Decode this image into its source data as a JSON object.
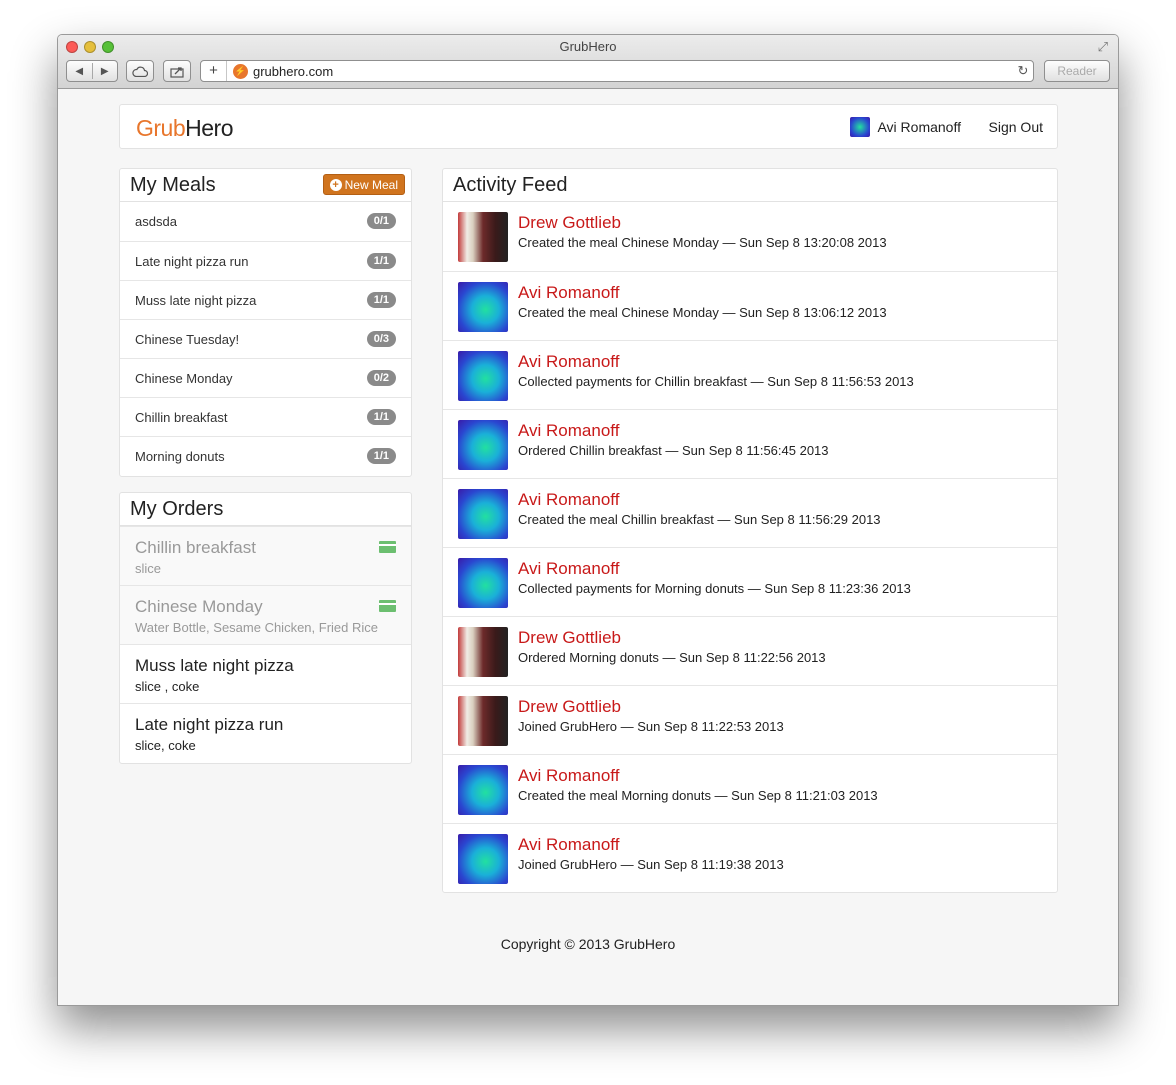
{
  "window": {
    "title": "GrubHero",
    "url": "grubhero.com",
    "reader_label": "Reader"
  },
  "brand": {
    "part1": "Grub",
    "part2": "Hero",
    "accent": "#e8762c"
  },
  "nav": {
    "user_name": "Avi Romanoff",
    "sign_out": "Sign Out"
  },
  "meals": {
    "title": "My Meals",
    "new_meal_label": "New Meal",
    "items": [
      {
        "name": "asdsda",
        "count": "0/1"
      },
      {
        "name": "Late night pizza run",
        "count": "1/1"
      },
      {
        "name": "Muss late night pizza",
        "count": "1/1"
      },
      {
        "name": "Chinese Tuesday!",
        "count": "0/3"
      },
      {
        "name": "Chinese Monday",
        "count": "0/2"
      },
      {
        "name": "Chillin breakfast",
        "count": "1/1"
      },
      {
        "name": "Morning donuts",
        "count": "1/1"
      }
    ]
  },
  "orders": {
    "title": "My Orders",
    "items": [
      {
        "meal": "Chillin breakfast",
        "items": "slice",
        "paid": true
      },
      {
        "meal": "Chinese Monday",
        "items": "Water Bottle, Sesame Chicken, Fried Rice",
        "paid": true
      },
      {
        "meal": "Muss late night pizza",
        "items": "slice , coke",
        "paid": false
      },
      {
        "meal": "Late night pizza run",
        "items": "slice, coke",
        "paid": false
      }
    ]
  },
  "feed": {
    "title": "Activity Feed",
    "name_color": "#c81919",
    "items": [
      {
        "user": "Drew Gottlieb",
        "text": "Created the meal Chinese Monday — Sun Sep 8 13:20:08 2013",
        "avatar": "drew"
      },
      {
        "user": "Avi Romanoff",
        "text": "Created the meal Chinese Monday — Sun Sep 8 13:06:12 2013",
        "avatar": "avi"
      },
      {
        "user": "Avi Romanoff",
        "text": "Collected payments for Chillin breakfast — Sun Sep 8 11:56:53 2013",
        "avatar": "avi"
      },
      {
        "user": "Avi Romanoff",
        "text": "Ordered Chillin breakfast — Sun Sep 8 11:56:45 2013",
        "avatar": "avi"
      },
      {
        "user": "Avi Romanoff",
        "text": "Created the meal Chillin breakfast — Sun Sep 8 11:56:29 2013",
        "avatar": "avi"
      },
      {
        "user": "Avi Romanoff",
        "text": "Collected payments for Morning donuts — Sun Sep 8 11:23:36 2013",
        "avatar": "avi"
      },
      {
        "user": "Drew Gottlieb",
        "text": "Ordered Morning donuts — Sun Sep 8 11:22:56 2013",
        "avatar": "drew"
      },
      {
        "user": "Drew Gottlieb",
        "text": "Joined GrubHero — Sun Sep 8 11:22:53 2013",
        "avatar": "drew"
      },
      {
        "user": "Avi Romanoff",
        "text": "Created the meal Morning donuts — Sun Sep 8 11:21:03 2013",
        "avatar": "avi"
      },
      {
        "user": "Avi Romanoff",
        "text": "Joined GrubHero — Sun Sep 8 11:19:38 2013",
        "avatar": "avi"
      }
    ]
  },
  "footer": {
    "copyright": "Copyright © 2013 GrubHero"
  }
}
